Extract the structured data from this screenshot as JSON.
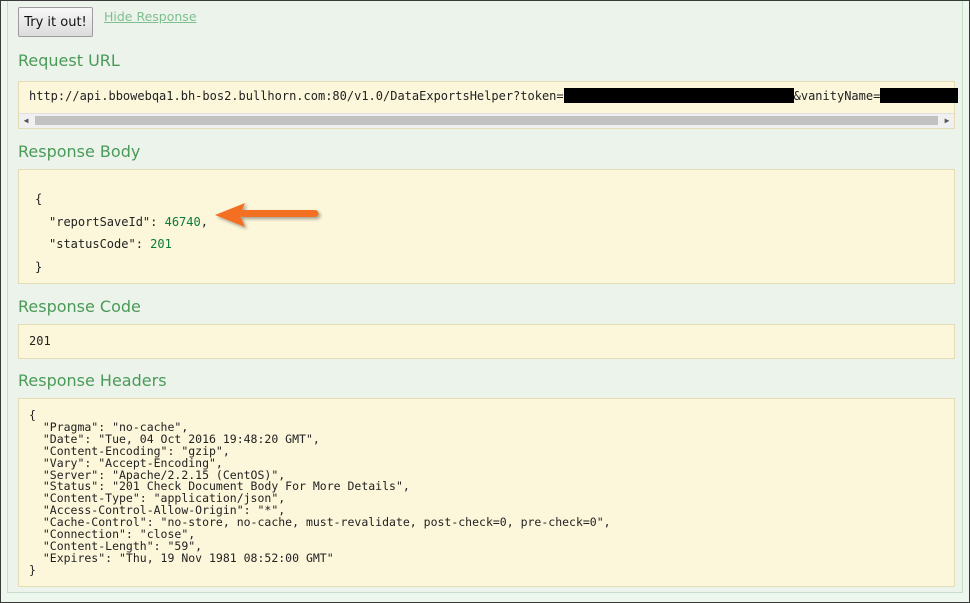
{
  "actions": {
    "try_label": "Try it out!",
    "hide_label": "Hide Response"
  },
  "request_url": {
    "title": "Request URL",
    "prefix": "http://api.bbowebqa1.bh-bos2.bullhorn.com:80/v1.0/DataExportsHelper?token=",
    "middle": "&vanityName="
  },
  "response_body": {
    "title": "Response Body",
    "open": "{",
    "key1": "\"reportSaveId\"",
    "val1": "46740",
    "key2": "\"statusCode\"",
    "val2": "201",
    "close": "}"
  },
  "response_code": {
    "title": "Response Code",
    "value": "201"
  },
  "response_headers": {
    "title": "Response Headers",
    "open": "{",
    "lines": [
      "  \"Pragma\": \"no-cache\",",
      "  \"Date\": \"Tue, 04 Oct 2016 19:48:20 GMT\",",
      "  \"Content-Encoding\": \"gzip\",",
      "  \"Vary\": \"Accept-Encoding\",",
      "  \"Server\": \"Apache/2.2.15 (CentOS)\",",
      "  \"Status\": \"201 Check Document Body For More Details\",",
      "  \"Content-Type\": \"application/json\",",
      "  \"Access-Control-Allow-Origin\": \"*\",",
      "  \"Cache-Control\": \"no-store, no-cache, must-revalidate, post-check=0, pre-check=0\",",
      "  \"Connection\": \"close\",",
      "  \"Content-Length\": \"59\",",
      "  \"Expires\": \"Thu, 19 Nov 1981 08:52:00 GMT\""
    ],
    "close": "}"
  },
  "colors": {
    "section_title": "#4a9a58",
    "response_bg": "#fcf6db",
    "highlight_arrow": "#f37021",
    "json_number": "#0a7a3a"
  },
  "icons": {
    "highlight": "arrow-left-icon",
    "scroll_left": "triangle-left-icon",
    "scroll_right": "triangle-right-icon"
  }
}
